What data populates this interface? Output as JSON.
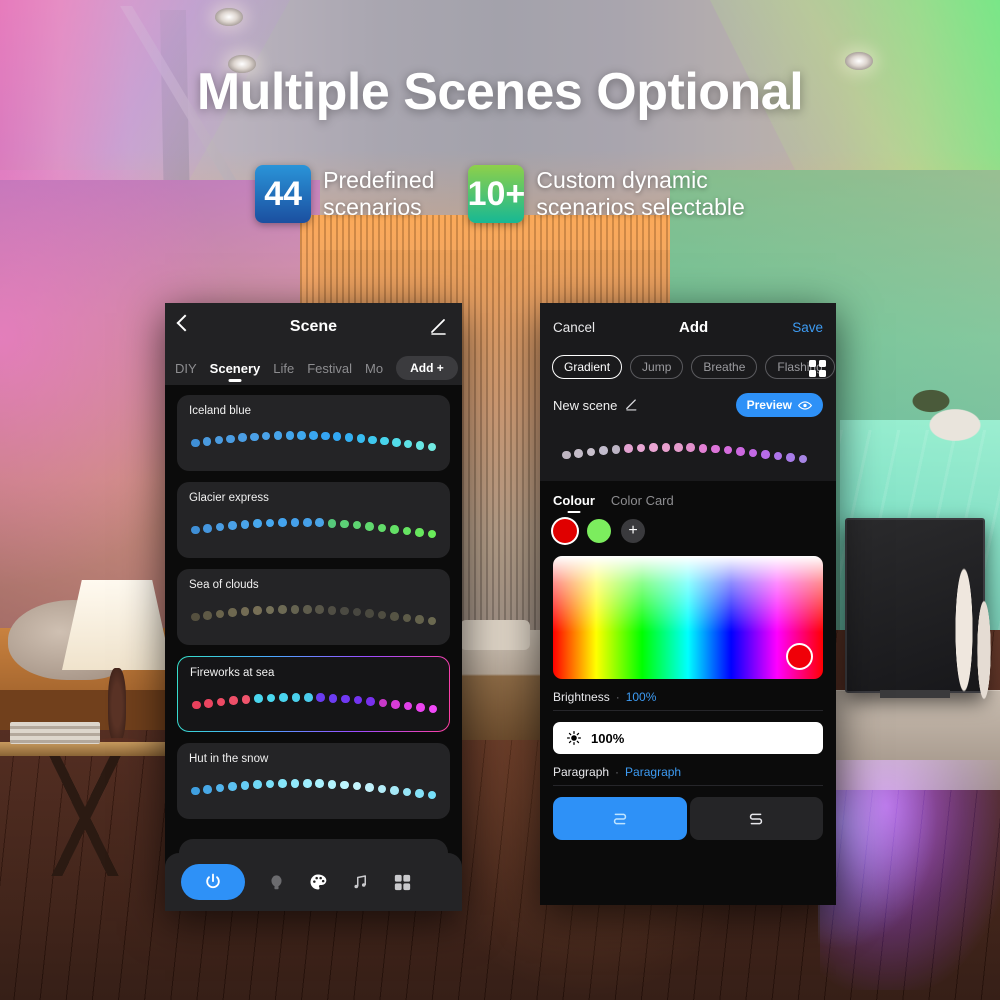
{
  "hero": {
    "title": "Multiple Scenes Optional",
    "badges": [
      {
        "value": "44",
        "line1": "Predefined",
        "line2": "scenarios",
        "color": "#1b4fa0"
      },
      {
        "value": "10+",
        "line1": "Custom dynamic",
        "line2": "scenarios selectable",
        "color": "#17b894"
      }
    ]
  },
  "phone_left": {
    "header": {
      "title": "Scene",
      "back_icon": "chevron-left-icon",
      "edit_icon": "pencil-icon"
    },
    "tabs": [
      {
        "label": "DIY",
        "active": false
      },
      {
        "label": "Scenery",
        "active": true
      },
      {
        "label": "Life",
        "active": false
      },
      {
        "label": "Festival",
        "active": false
      },
      {
        "label": "Mo",
        "active": false
      }
    ],
    "add_button": "Add +",
    "scenes": [
      {
        "name": "Iceland blue",
        "selected": false,
        "colors": [
          "#3f8fd6",
          "#4a9ade",
          "#4b9ce0",
          "#4a9ce2",
          "#4b9ee4",
          "#4ba0e6",
          "#4aa2e8",
          "#47a4ea",
          "#43a6ec",
          "#3fa8ee",
          "#3aa6f0",
          "#35a4f2",
          "#32a8f4",
          "#34b0f2",
          "#38bcf0",
          "#3fc8ee",
          "#48d4ec",
          "#52dce9",
          "#5ee2e6",
          "#68e6e4",
          "#72eae2"
        ]
      },
      {
        "name": "Glacier express",
        "selected": false,
        "colors": [
          "#3f8fd6",
          "#4596dd",
          "#4a9de2",
          "#4aa0e6",
          "#4aa4ea",
          "#48a8ee",
          "#46a8f0",
          "#44a4ee",
          "#45a0ea",
          "#46a0e8",
          "#4aa4e6",
          "#56c87a",
          "#5cd076",
          "#5ed472",
          "#60d86e",
          "#62dc6a",
          "#64e066",
          "#66e462",
          "#68e85e",
          "#6aec5a"
        ]
      },
      {
        "name": "Sea of clouds",
        "selected": false,
        "colors": [
          "#55503f",
          "#5f5a46",
          "#6a644c",
          "#6e6850",
          "#736c54",
          "#776f56",
          "#747058",
          "#6d6a54",
          "#656350",
          "#5e5c4c",
          "#575548",
          "#504e44",
          "#4b4a42",
          "#484740",
          "#4a493f",
          "#4f4d41",
          "#565444",
          "#5d5b48",
          "#64624c",
          "#6b6950"
        ]
      },
      {
        "name": "Fireworks at sea",
        "selected": true,
        "colors": [
          "#e8405c",
          "#ea4560",
          "#ec4a64",
          "#ee4f68",
          "#f0546c",
          "#4ad6ee",
          "#4ad8f0",
          "#4ad4ee",
          "#4ad0ec",
          "#4accec",
          "#6a3cf0",
          "#6c3cf2",
          "#7038f4",
          "#7434f0",
          "#7830ee",
          "#c838c8",
          "#d83cd8",
          "#e040e8",
          "#ea44f0",
          "#f048f8"
        ]
      },
      {
        "name": "Hut in the snow",
        "selected": false,
        "colors": [
          "#3f9fe0",
          "#48a8e6",
          "#52b4ec",
          "#5cc0f0",
          "#66ccf4",
          "#70d8f6",
          "#7ae0f8",
          "#86e6fa",
          "#92eafc",
          "#9eeefe",
          "#aaf2fe",
          "#b4f4fe",
          "#bef6fe",
          "#c4f4fc",
          "#c0f0fa",
          "#b4ecf8",
          "#a6e8f6",
          "#96e4f6",
          "#86e2f8",
          "#76e0fa"
        ]
      }
    ],
    "bottombar": [
      {
        "icon": "power-icon",
        "label": "Power",
        "active": true
      },
      {
        "icon": "bulb-icon",
        "label": "Light",
        "active": false
      },
      {
        "icon": "palette-icon",
        "label": "Colour",
        "active": true
      },
      {
        "icon": "music-icon",
        "label": "Music",
        "active": false
      },
      {
        "icon": "grid-icon",
        "label": "More",
        "active": false
      }
    ]
  },
  "phone_right": {
    "header": {
      "cancel": "Cancel",
      "title": "Add",
      "save": "Save"
    },
    "modes": [
      {
        "label": "Gradient",
        "active": true
      },
      {
        "label": "Jump",
        "active": false
      },
      {
        "label": "Breathe",
        "active": false
      },
      {
        "label": "Flashing",
        "active": false
      }
    ],
    "grid_icon": "grid-icon",
    "scene_name": "New scene",
    "scene_name_edit_icon": "pencil-icon",
    "preview_button": {
      "label": "Preview",
      "icon": "eye-icon"
    },
    "preview_colors": [
      "#bdb4c0",
      "#c4bcc8",
      "#c8c0cc",
      "#c2bccc",
      "#bcb4c4",
      "#e2a2d0",
      "#e8a6d4",
      "#eaa4d2",
      "#e8a0ce",
      "#e49ccc",
      "#e290cc",
      "#e280d4",
      "#dc74d8",
      "#d46cdc",
      "#cc68e0",
      "#c268e4",
      "#b86ce8",
      "#ae74ea",
      "#a87ce8",
      "#a684e4"
    ],
    "section_tabs": [
      {
        "label": "Colour",
        "active": true
      },
      {
        "label": "Color Card",
        "active": false
      }
    ],
    "swatches": [
      {
        "color": "#e00000",
        "selected": true
      },
      {
        "color": "#7ced5e",
        "selected": false
      }
    ],
    "swatch_add": "+",
    "picker": {
      "selected_color": "#f00008"
    },
    "brightness": {
      "label": "Brightness",
      "separator": "·",
      "value": "100%",
      "bar_icon": "sun-icon",
      "bar_value": "100%"
    },
    "paragraph": {
      "label": "Paragraph",
      "separator": "·",
      "value": "Paragraph",
      "segments": [
        {
          "icon": "flow-forward-icon",
          "active": true
        },
        {
          "icon": "flow-reverse-icon",
          "active": false
        }
      ]
    }
  }
}
